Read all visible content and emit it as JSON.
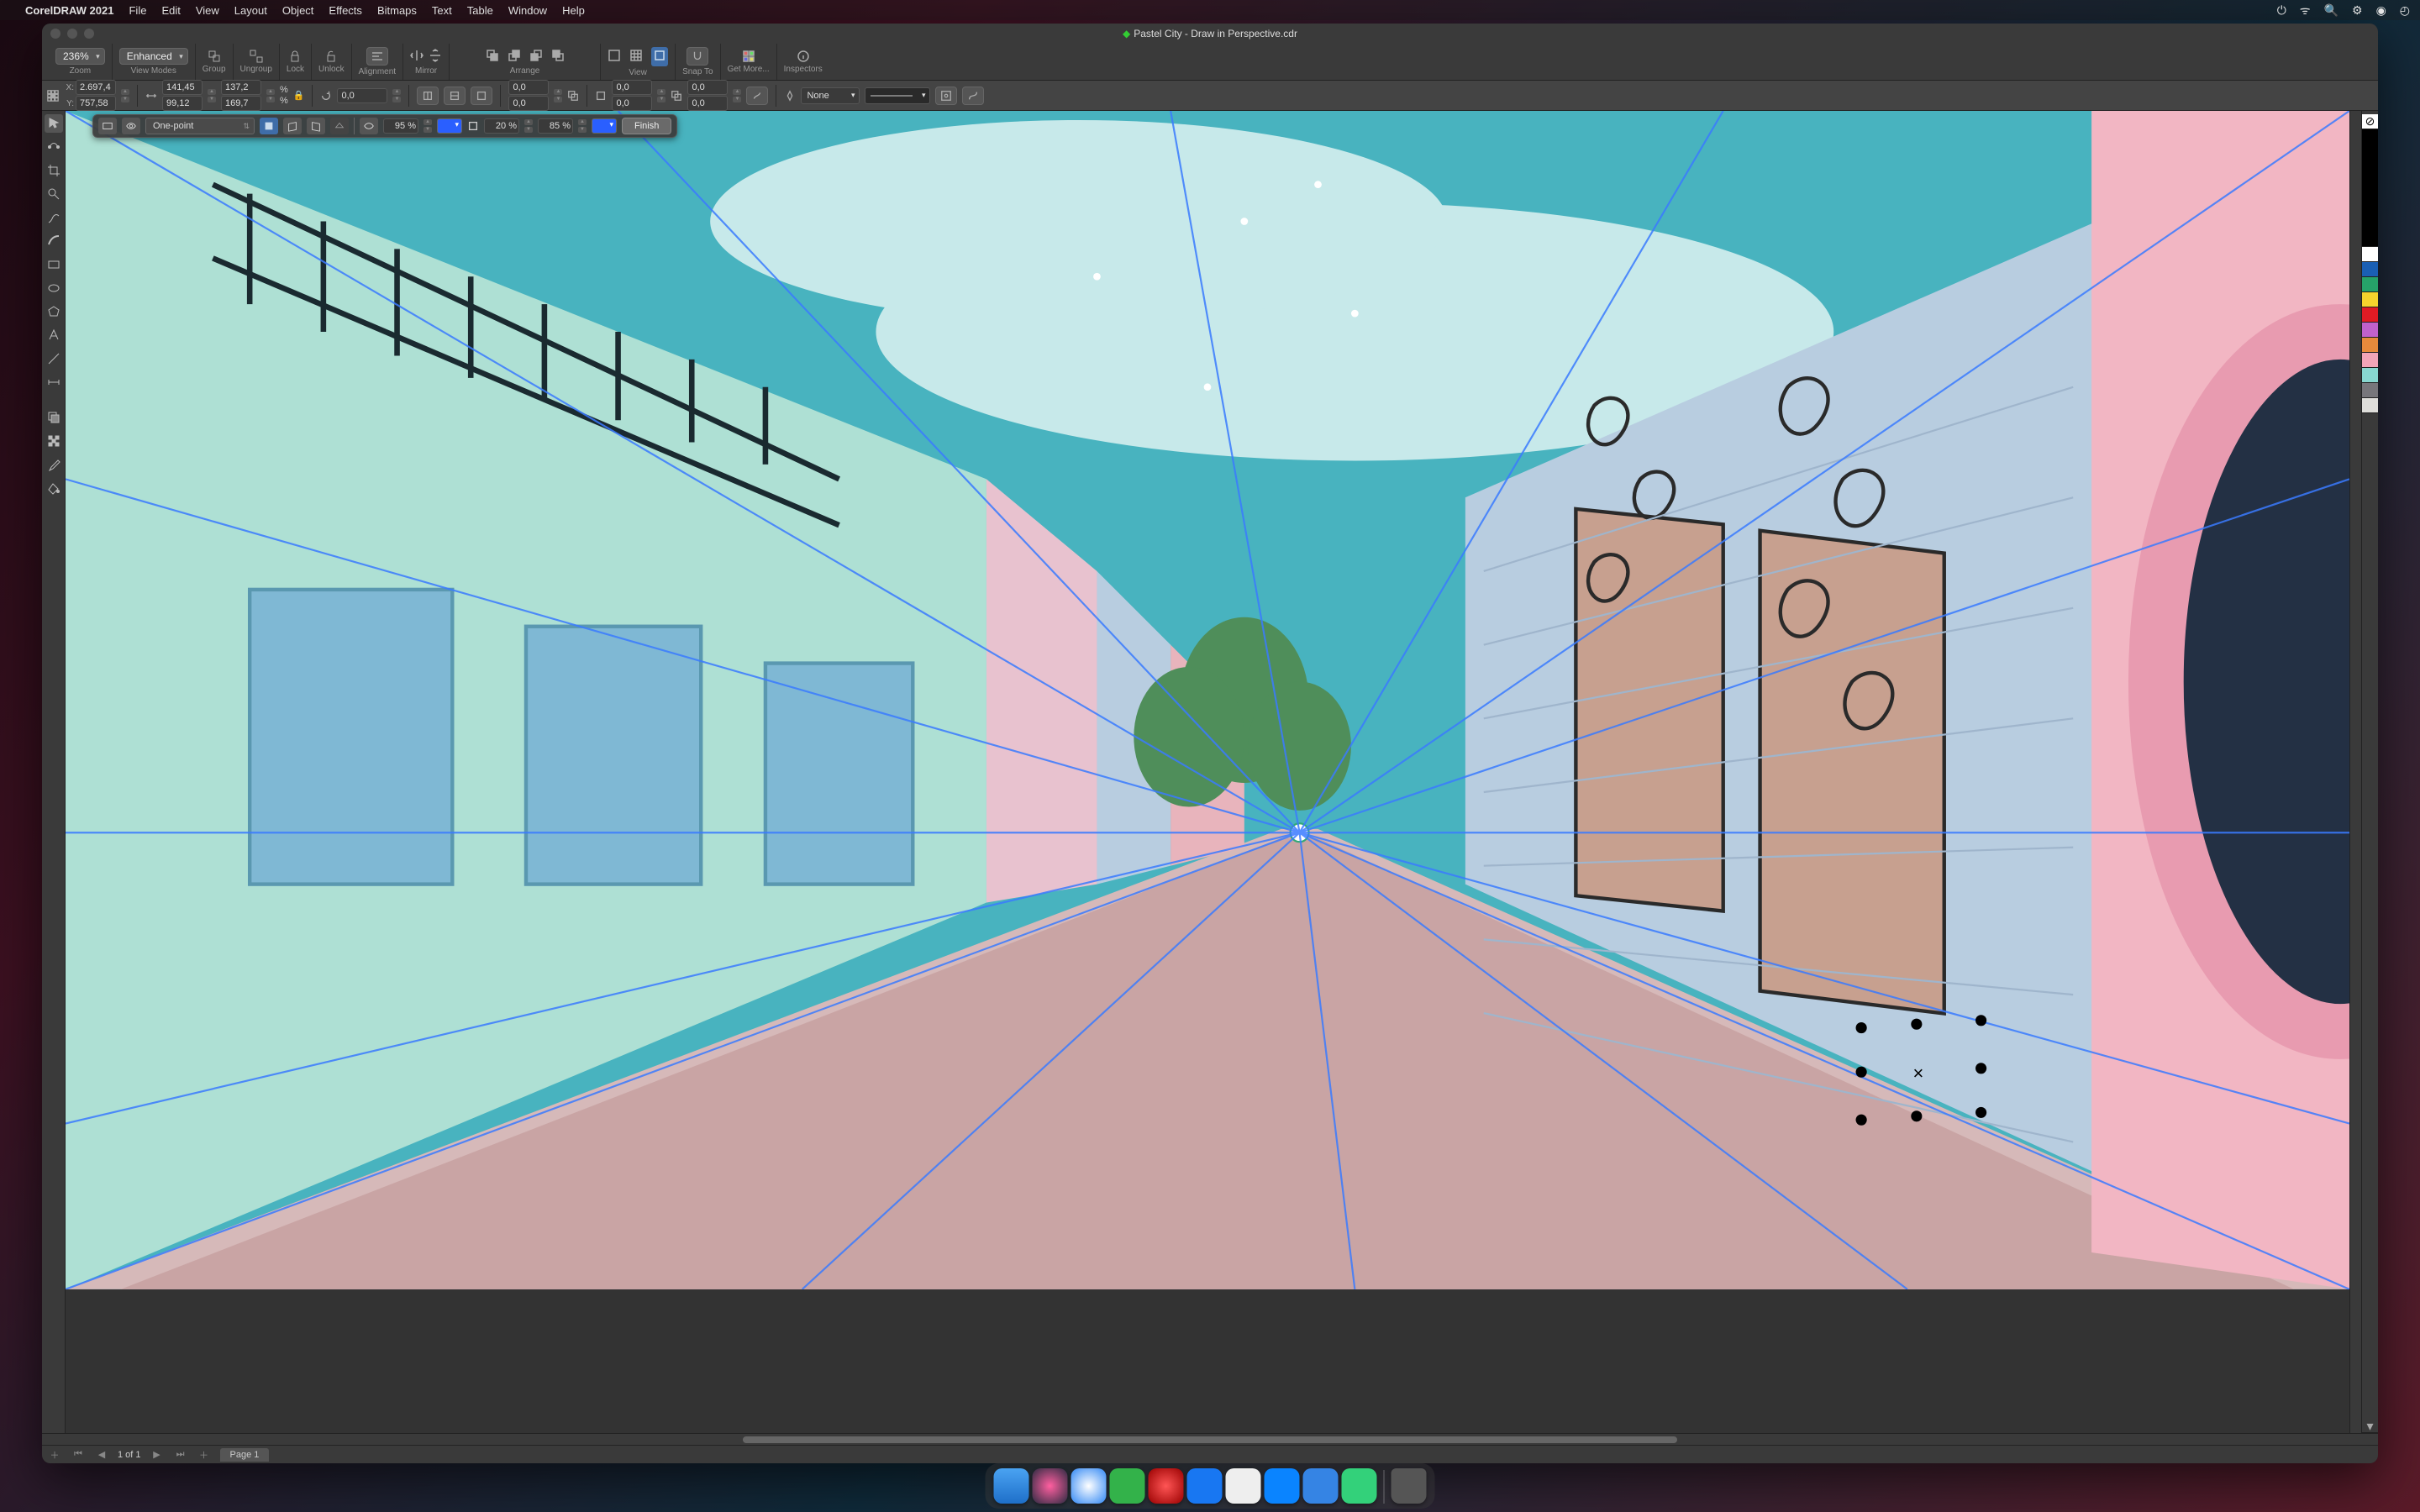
{
  "menubar": {
    "app_name": "CorelDRAW 2021",
    "items": [
      "File",
      "Edit",
      "View",
      "Layout",
      "Object",
      "Effects",
      "Bitmaps",
      "Text",
      "Table",
      "Window",
      "Help"
    ]
  },
  "titlebar": {
    "title": "Pastel City - Draw in Perspective.cdr"
  },
  "toolbar1": {
    "zoom_value": "236%",
    "zoom_label": "Zoom",
    "view_mode_value": "Enhanced",
    "view_mode_label": "View Modes",
    "group_label": "Group",
    "ungroup_label": "Ungroup",
    "lock_label": "Lock",
    "unlock_label": "Unlock",
    "alignment_label": "Alignment",
    "mirror_label": "Mirror",
    "arrange_label": "Arrange",
    "view_label": "View",
    "snap_label": "Snap To",
    "getmore_label": "Get More...",
    "inspectors_label": "Inspectors"
  },
  "propbar": {
    "x_label": "X:",
    "x_value": "2.697,4",
    "y_label": "Y:",
    "y_value": "757,58",
    "w_value": "141,45",
    "h_value": "99,12",
    "sx_value": "137,2",
    "sy_value": "169,7",
    "pct": "%",
    "angle_value": "0,0",
    "skew_x": "0,0",
    "skew_y": "0,0",
    "dup_x": "0,0",
    "dup_y": "0,0",
    "dup2_x": "0,0",
    "dup2_y": "0,0",
    "outline_value": "None"
  },
  "perspective_bar": {
    "type_value": "One-point",
    "opacity1": "95 %",
    "opacity2": "20 %",
    "opacity3": "85 %",
    "color1": "#2a5fff",
    "color2": "#2a5fff",
    "finish_label": "Finish"
  },
  "pagebar": {
    "page_count": "1 of 1",
    "page_tab": "Page 1"
  },
  "palette": [
    "#ffffff",
    "#000000",
    "#ffffff",
    "#1a5fb4",
    "#26a269",
    "#f6d32d",
    "#e01b24",
    "#c061cb",
    "#865e3c",
    "#f2a4b7",
    "#88d7d0",
    "#77767b",
    "#deddda"
  ],
  "dock_colors": [
    "#2e86f4",
    "#1e1e1e",
    "#3584e4",
    "#33d17a",
    "#c01c28",
    "#3584e4",
    "#f5c211",
    "#3584e4",
    "#3584e4",
    "#26a269"
  ]
}
